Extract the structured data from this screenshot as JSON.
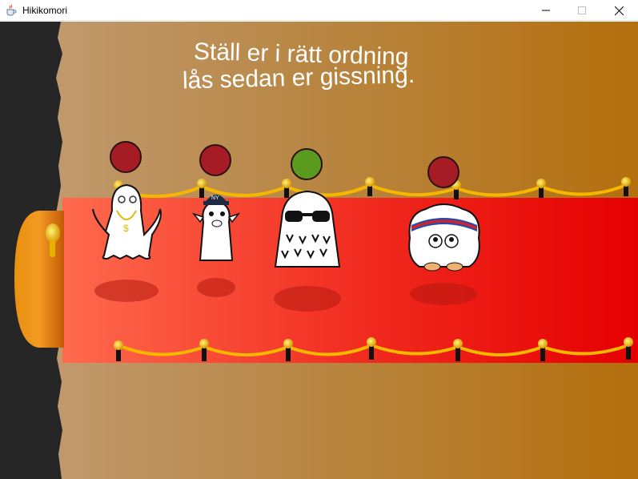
{
  "window": {
    "title": "Hikikomori",
    "icon": "java-cup-icon",
    "controls": [
      "minimize-icon",
      "maximize-icon",
      "close-icon"
    ]
  },
  "game": {
    "instruction_line1": "Ställ er i rätt ordning",
    "instruction_line2": "lås sedan er gissning.",
    "colors": {
      "background_light": "#c09a72",
      "background_dark": "#b5700f",
      "carpet_left": "#ff6347",
      "carpet_right": "#e60000",
      "rope": "#f5b400",
      "door": "#f07b10",
      "wall": "#262626",
      "indicator_red": "#a51c24",
      "indicator_green": "#5a9a1e"
    },
    "characters": [
      {
        "id": "ghost-gangster",
        "indicator": "red"
      },
      {
        "id": "goat-with-cap",
        "indicator": "red"
      },
      {
        "id": "furry-with-sunglasses",
        "indicator": "green"
      },
      {
        "id": "fluffy-headband",
        "indicator": "red"
      }
    ]
  }
}
